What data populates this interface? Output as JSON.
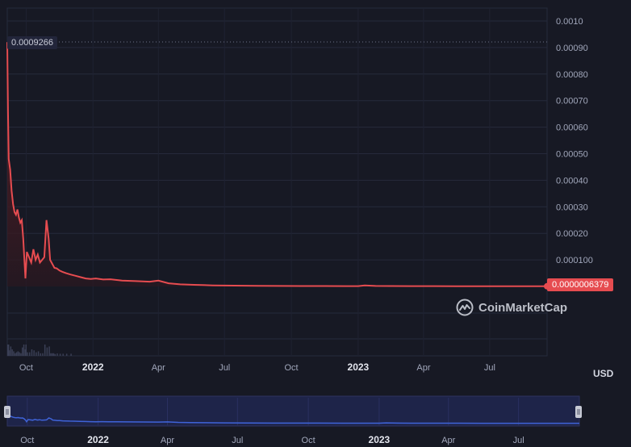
{
  "colors": {
    "background": "#171924",
    "grid": "#262a3b",
    "price_line": "#e64c50",
    "navigator_line": "#3f63d8",
    "navigator_fill": "#1e2449"
  },
  "labels": {
    "max_marker": "0.0009266",
    "current_price": "0.0000006379",
    "currency": "USD",
    "watermark": "CoinMarketCap"
  },
  "chart_data": {
    "type": "area",
    "title": "",
    "xlabel": "",
    "ylabel": "",
    "ylim": [
      0,
      0.00102
    ],
    "xlim": [
      "2021-09-05",
      "2023-09-18"
    ],
    "y_ticks": [
      "0.0010",
      "0.00090",
      "0.00080",
      "0.00070",
      "0.00060",
      "0.00050",
      "0.00040",
      "0.00030",
      "0.00020",
      "0.000100"
    ],
    "y_tick_values": [
      0.001,
      0.0009,
      0.0008,
      0.0007,
      0.0006,
      0.0005,
      0.0004,
      0.0003,
      0.0002,
      0.0001
    ],
    "x_ticks": [
      {
        "label": "Oct",
        "date": "2021-10-01",
        "major": false
      },
      {
        "label": "2022",
        "date": "2022-01-01",
        "major": true
      },
      {
        "label": "Apr",
        "date": "2022-04-01",
        "major": false
      },
      {
        "label": "Jul",
        "date": "2022-07-01",
        "major": false
      },
      {
        "label": "Oct",
        "date": "2022-10-01",
        "major": false
      },
      {
        "label": "2023",
        "date": "2023-01-01",
        "major": true
      },
      {
        "label": "Apr",
        "date": "2023-04-01",
        "major": false
      },
      {
        "label": "Jul",
        "date": "2023-07-01",
        "major": false
      }
    ],
    "max_value": 0.0009266,
    "current_value": 6.379e-07,
    "grid": true,
    "series": [
      {
        "x": [
          "2021-09-05",
          "2021-09-06",
          "2021-09-07",
          "2021-09-09",
          "2021-09-11",
          "2021-09-13",
          "2021-09-15",
          "2021-09-17",
          "2021-09-19",
          "2021-09-21",
          "2021-09-23",
          "2021-09-25",
          "2021-09-27",
          "2021-09-29",
          "2021-09-30",
          "2021-10-02",
          "2021-10-05",
          "2021-10-08",
          "2021-10-11",
          "2021-10-14",
          "2021-10-17",
          "2021-10-20",
          "2021-10-23",
          "2021-10-26",
          "2021-10-29",
          "2021-11-01",
          "2021-11-03",
          "2021-11-05",
          "2021-11-07",
          "2021-11-09",
          "2021-11-12",
          "2021-11-16",
          "2021-11-20",
          "2021-11-25",
          "2021-12-01",
          "2021-12-08",
          "2021-12-15",
          "2021-12-22",
          "2021-12-29",
          "2022-01-05",
          "2022-01-15",
          "2022-01-25",
          "2022-02-10",
          "2022-03-01",
          "2022-03-20",
          "2022-04-01",
          "2022-04-15",
          "2022-05-01",
          "2022-05-20",
          "2022-06-15",
          "2022-07-15",
          "2022-08-15",
          "2022-09-15",
          "2022-10-15",
          "2022-11-15",
          "2022-12-15",
          "2023-01-01",
          "2023-01-10",
          "2023-01-25",
          "2023-02-15",
          "2023-03-15",
          "2023-04-15",
          "2023-05-15",
          "2023-06-15",
          "2023-07-15",
          "2023-08-15",
          "2023-09-18"
        ],
        "values": [
          0.00092,
          0.00066,
          0.00048,
          0.00044,
          0.00036,
          0.00031,
          0.00028,
          0.00027,
          0.00029,
          0.00026,
          0.00024,
          0.00025,
          0.00018,
          8e-05,
          3e-05,
          0.00013,
          0.00011,
          9e-05,
          0.00014,
          0.0001,
          0.00012,
          9e-05,
          0.0001,
          0.00011,
          0.00025,
          0.00018,
          0.0001,
          9e-05,
          8e-05,
          7e-05,
          6.8e-05,
          6e-05,
          5.5e-05,
          5e-05,
          4.5e-05,
          4e-05,
          3.5e-05,
          3e-05,
          2.8e-05,
          3e-05,
          2.6e-05,
          2.7e-05,
          2.2e-05,
          2e-05,
          1.8e-05,
          2.2e-05,
          1.2e-05,
          8e-06,
          6e-06,
          4e-06,
          3e-06,
          2e-06,
          1.8e-06,
          1.6e-06,
          1.5e-06,
          1.3e-06,
          1.2e-06,
          4e-06,
          1.8e-06,
          1.4e-06,
          1.2e-06,
          1.1e-06,
          1e-06,
          9e-07,
          8e-07,
          7e-07,
          6.379e-07
        ]
      }
    ]
  }
}
